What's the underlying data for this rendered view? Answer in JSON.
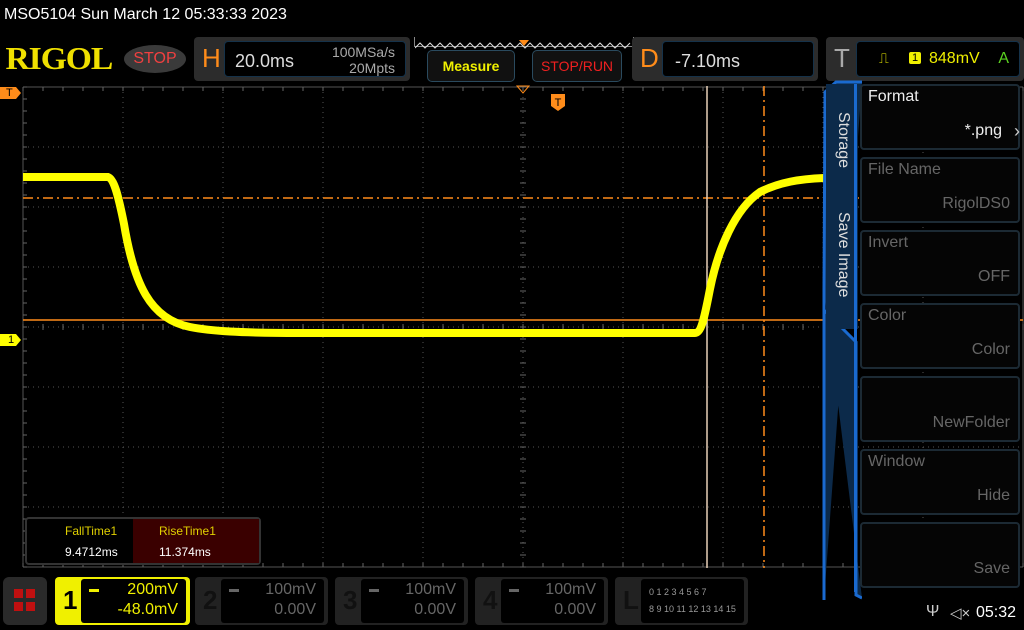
{
  "title": "MSO5104  Sun March 12 05:33:33 2023",
  "logo": "RIGOL",
  "run_state": "STOP",
  "horizontal": {
    "letter": "H",
    "timebase": "20.0ms",
    "sample_rate": "100MSa/s",
    "memory_depth": "20Mpts"
  },
  "buttons": {
    "measure": "Measure",
    "stop_run": "STOP/RUN"
  },
  "delay": {
    "letter": "D",
    "value": "-7.10ms"
  },
  "trigger": {
    "letter": "T",
    "source": "1",
    "level": "848mV",
    "mode": "A"
  },
  "markers": {
    "trigger": "T",
    "channel1": "1"
  },
  "side_tabs": {
    "storage": "Storage",
    "save_image": "Save Image"
  },
  "menu": [
    {
      "label": "Format",
      "value": "*.png"
    },
    {
      "label": "File Name",
      "value": "RigolDS0"
    },
    {
      "label": "Invert",
      "value": "OFF"
    },
    {
      "label": "Color",
      "value": "Color"
    },
    {
      "label": "",
      "value": "NewFolder"
    },
    {
      "label": "Window",
      "value": "Hide"
    },
    {
      "label": "",
      "value": "Save"
    }
  ],
  "measurements": [
    {
      "name": "FallTime1",
      "value": "9.4712ms"
    },
    {
      "name": "RiseTime1",
      "value": "11.374ms"
    }
  ],
  "channels": [
    {
      "num": "1",
      "scale": "200mV",
      "offset": "-48.0mV"
    },
    {
      "num": "2",
      "scale": "100mV",
      "offset": "0.00V"
    },
    {
      "num": "3",
      "scale": "100mV",
      "offset": "0.00V"
    },
    {
      "num": "4",
      "scale": "100mV",
      "offset": "0.00V"
    }
  ],
  "logic": {
    "letter": "L",
    "row1": "0 1 2 3  4 5 6 7",
    "row2": "8 9 10 11 12 13 14 15"
  },
  "status": {
    "time": "05:32",
    "usb": "usb-icon",
    "sound": "mute-icon"
  },
  "colors": {
    "ch1": "#ffff00",
    "cursor": "#ff8c1a",
    "stop": "#f04040"
  }
}
